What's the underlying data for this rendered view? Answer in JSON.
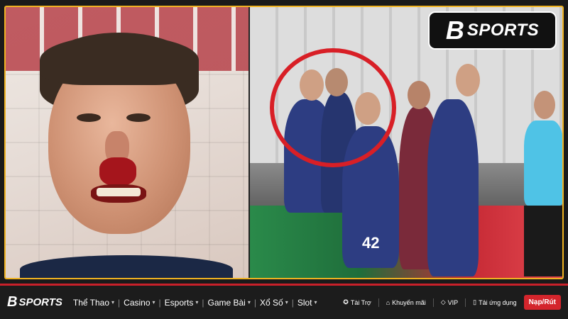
{
  "logo": {
    "mark": "B",
    "text": "SPORTS"
  },
  "photo": {
    "jersey_number": "42"
  },
  "nav": {
    "logo_mark": "B",
    "logo_text": "SPORTS",
    "items": [
      {
        "label": "Thể Thao",
        "icon": "chevron-down-icon"
      },
      {
        "label": "Casino",
        "icon": "chevron-down-icon"
      },
      {
        "label": "Esports",
        "icon": "chevron-down-icon"
      },
      {
        "label": "Game Bài",
        "icon": "chevron-down-icon"
      },
      {
        "label": "Xổ Số",
        "icon": "chevron-down-icon"
      },
      {
        "label": "Slot",
        "icon": "chevron-down-icon"
      }
    ],
    "links": [
      {
        "label": "Tài Trợ",
        "icon": "sponsor-icon"
      },
      {
        "label": "Khuyến mãi",
        "icon": "tag-icon"
      },
      {
        "label": "VIP",
        "icon": "diamond-icon"
      },
      {
        "label": "Tải ứng dụng",
        "icon": "phone-icon"
      }
    ],
    "cta_label": "Nạp/Rút"
  },
  "colors": {
    "accent": "#d4252c",
    "frame": "#f0b321",
    "navbar_bg": "#1c1c1c"
  }
}
